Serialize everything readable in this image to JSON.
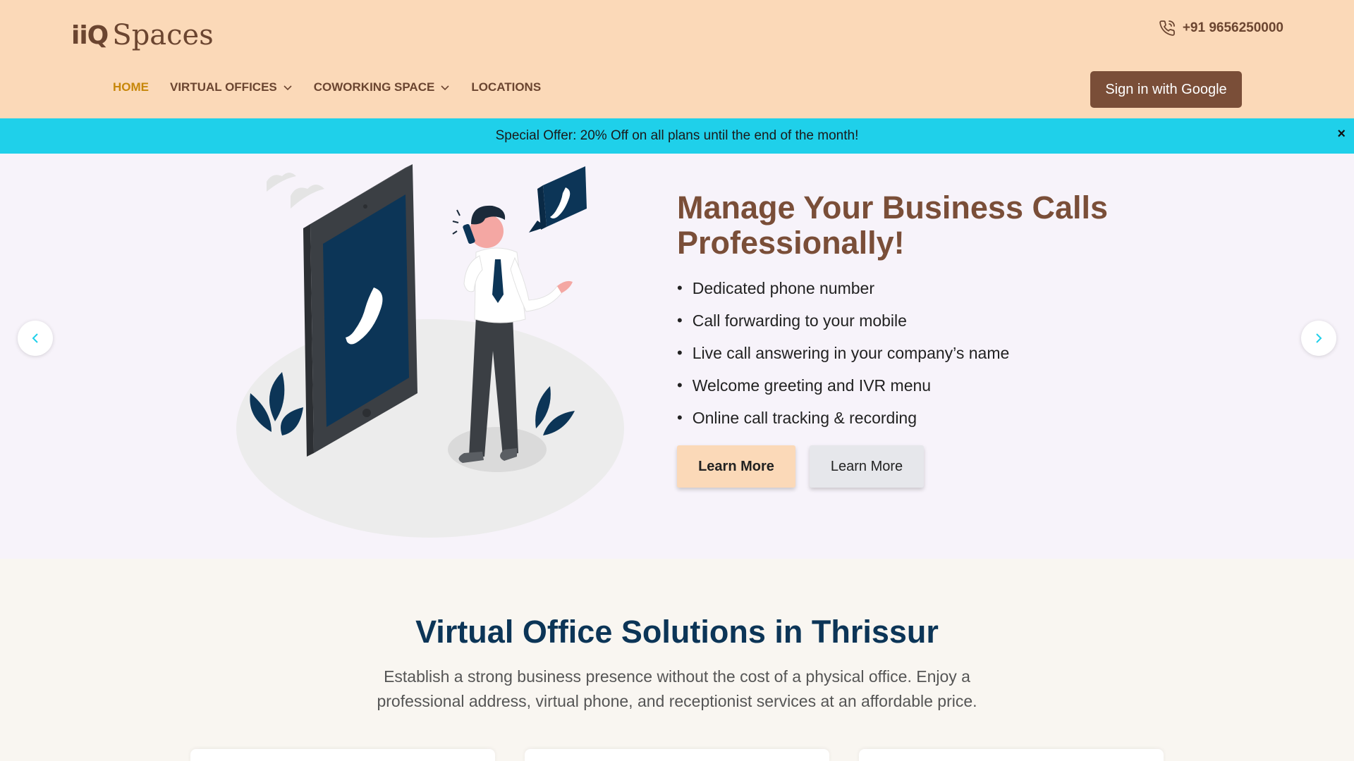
{
  "header": {
    "logo_iiq": "iiQ",
    "logo_spaces": "Spaces",
    "phone": "+91 9656250000",
    "nav": [
      {
        "label": "HOME"
      },
      {
        "label": "VIRTUAL OFFICES"
      },
      {
        "label": "COWORKING SPACE"
      },
      {
        "label": "LOCATIONS"
      }
    ],
    "signin_label": "Sign in with Google"
  },
  "offer": {
    "text": "Special Offer: 20% Off on all plans until the end of the month!",
    "close": "×"
  },
  "hero": {
    "title": "Manage Your Business Calls Professionally!",
    "features": [
      "Dedicated phone number",
      "Call forwarding to your mobile",
      "Live call answering in your company’s name",
      "Welcome greeting and IVR menu",
      "Online call tracking & recording"
    ],
    "primary_label": "Learn More",
    "secondary_label": "Learn More"
  },
  "section": {
    "title": "Virtual Office Solutions in Thrissur",
    "description": "Establish a strong business presence without the cost of a physical office. Enjoy a professional address, virtual phone, and receptionist services at an affordable price."
  },
  "colors": {
    "header_bg": "#fbd9b8",
    "brand_brown": "#7a4e38",
    "nav_active": "#c7870a",
    "offer_bg": "#1fd0ea",
    "section_title": "#0c3557",
    "arrow_accent": "#1fd0ea"
  },
  "icons": {
    "phone": "phone-call-icon",
    "dropdown": "chevron-down-icon",
    "prev": "chevron-left-icon",
    "next": "chevron-right-icon"
  }
}
